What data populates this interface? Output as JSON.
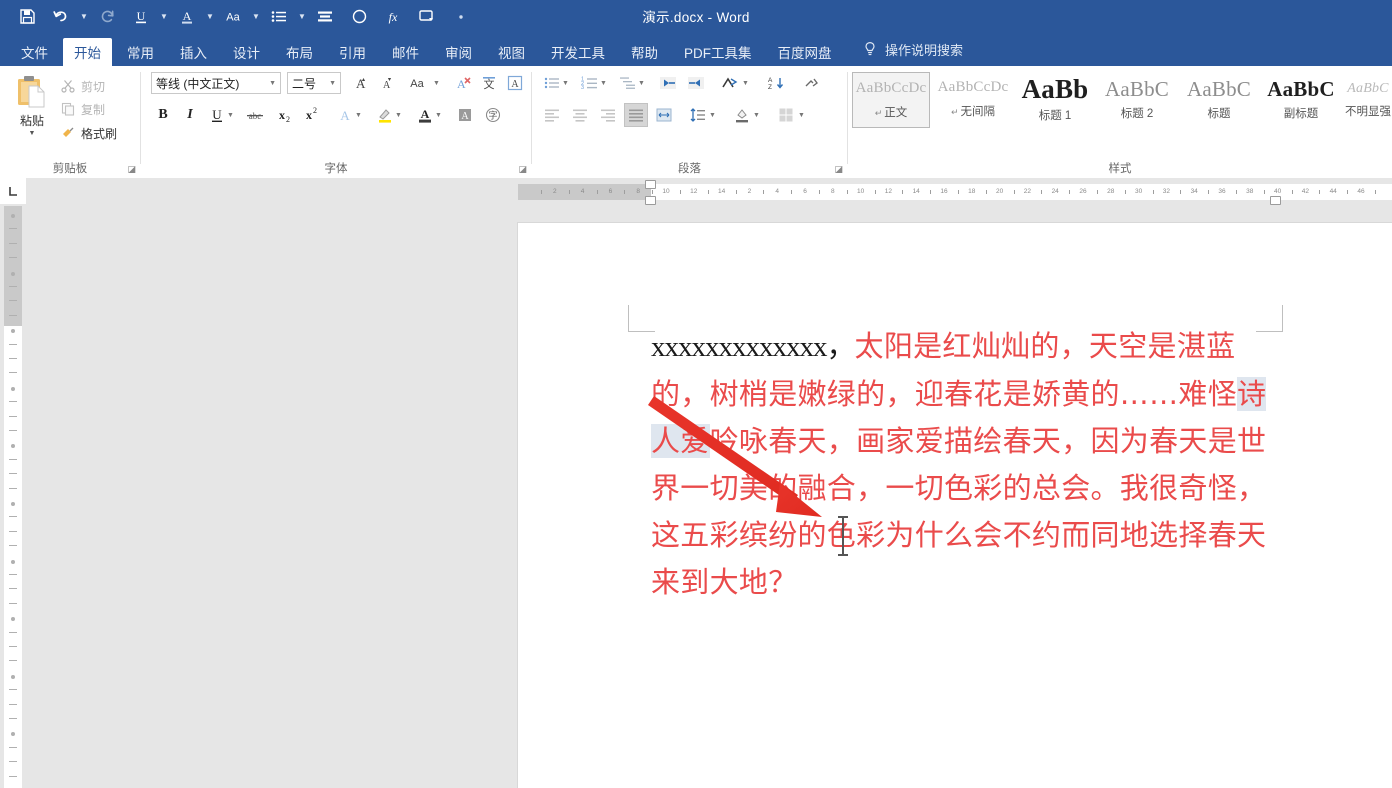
{
  "window": {
    "title": "演示.docx  -  Word",
    "accent": "#2b579a"
  },
  "quick_access": {
    "items": [
      {
        "name": "save-icon",
        "glyph": "save",
        "caret": false,
        "dim": false
      },
      {
        "name": "undo-icon",
        "glyph": "undo",
        "caret": true,
        "dim": false
      },
      {
        "name": "redo-icon",
        "glyph": "redo",
        "caret": false,
        "dim": true
      },
      {
        "name": "underline-icon",
        "glyph": "U",
        "caret": true,
        "dim": false
      },
      {
        "name": "font-color-icon",
        "glyph": "A",
        "caret": true,
        "dim": false
      },
      {
        "name": "change-case-icon",
        "glyph": "Aa",
        "caret": true,
        "dim": false
      },
      {
        "name": "bullets-icon",
        "glyph": "list",
        "caret": true,
        "dim": false
      },
      {
        "name": "paragraph-align-icon",
        "glyph": "align",
        "caret": false,
        "dim": false
      },
      {
        "name": "circle-icon",
        "glyph": "circle",
        "caret": false,
        "dim": false
      },
      {
        "name": "function-icon",
        "glyph": "fx",
        "caret": false,
        "dim": false
      },
      {
        "name": "screenshot-icon",
        "glyph": "screen",
        "caret": false,
        "dim": false
      },
      {
        "name": "customize-qat-icon",
        "glyph": "dot",
        "caret": false,
        "dim": false
      }
    ]
  },
  "tabs": [
    {
      "label": "文件",
      "active": false,
      "name": "tab-file"
    },
    {
      "label": "开始",
      "active": true,
      "name": "tab-home"
    },
    {
      "label": "常用",
      "active": false,
      "name": "tab-common"
    },
    {
      "label": "插入",
      "active": false,
      "name": "tab-insert"
    },
    {
      "label": "设计",
      "active": false,
      "name": "tab-design"
    },
    {
      "label": "布局",
      "active": false,
      "name": "tab-layout"
    },
    {
      "label": "引用",
      "active": false,
      "name": "tab-references"
    },
    {
      "label": "邮件",
      "active": false,
      "name": "tab-mailings"
    },
    {
      "label": "审阅",
      "active": false,
      "name": "tab-review"
    },
    {
      "label": "视图",
      "active": false,
      "name": "tab-view"
    },
    {
      "label": "开发工具",
      "active": false,
      "name": "tab-developer"
    },
    {
      "label": "帮助",
      "active": false,
      "name": "tab-help"
    },
    {
      "label": "PDF工具集",
      "active": false,
      "name": "tab-pdf-tools"
    },
    {
      "label": "百度网盘",
      "active": false,
      "name": "tab-baidu-netdisk"
    }
  ],
  "tell_me": {
    "label": "操作说明搜索",
    "icon": "lightbulb-icon"
  },
  "ribbon": {
    "groups": [
      {
        "name": "clipboard",
        "label": "剪贴板"
      },
      {
        "name": "font",
        "label": "字体"
      },
      {
        "name": "paragraph",
        "label": "段落"
      },
      {
        "name": "styles",
        "label": "样式"
      }
    ],
    "clipboard": {
      "paste_label": "粘贴",
      "cut_label": "剪切",
      "copy_label": "复制",
      "format_painter_label": "格式刷"
    },
    "font": {
      "font_name": "等线 (中文正文)",
      "font_size": "二号"
    },
    "styles": [
      {
        "preview": "AaBbCcDc",
        "name": "正文",
        "mark": "↵",
        "selected": true
      },
      {
        "preview": "AaBbCcDc",
        "name": "无间隔",
        "mark": "↵",
        "selected": false
      },
      {
        "preview": "AaBb",
        "name": "标题 1",
        "mark": "",
        "selected": false
      },
      {
        "preview": "AaBbC",
        "name": "标题 2",
        "mark": "",
        "selected": false
      },
      {
        "preview": "AaBbC",
        "name": "标题",
        "mark": "",
        "selected": false
      },
      {
        "preview": "AaBbC",
        "name": "副标题",
        "mark": "",
        "selected": false
      },
      {
        "preview": "AaBbC",
        "name": "不明显强",
        "mark": "",
        "selected": false
      }
    ]
  },
  "document": {
    "prefix_black": "xxxxxxxxxxxxx，",
    "body_red": "太阳是红灿灿的，天空是湛蓝的，树梢是嫩绿的，迎春花是娇黄的……难怪诗人爱吟咏春天，画家爱描绘春天，因为春天是世界一切美的融合，一切色彩的总会。我很奇怪，这五彩缤纷的色彩为什么会不约而同地选择春天来到大地？",
    "text_color": "#ea4b4b",
    "highlight_text": "诗人爱",
    "highlight_color": "#dfe6ef"
  },
  "annotation": {
    "arrow_color": "#e8342a",
    "name": "red-arrow-annotation"
  },
  "ruler": {
    "h_numbers": [
      "2",
      "4",
      "6",
      "8",
      "10",
      "12",
      "14",
      "2",
      "4",
      "6",
      "8",
      "10",
      "12",
      "14",
      "16",
      "18",
      "20",
      "22",
      "24",
      "26",
      "28",
      "30",
      "32",
      "34",
      "36",
      "38",
      "40",
      "42",
      "44",
      "46"
    ]
  }
}
